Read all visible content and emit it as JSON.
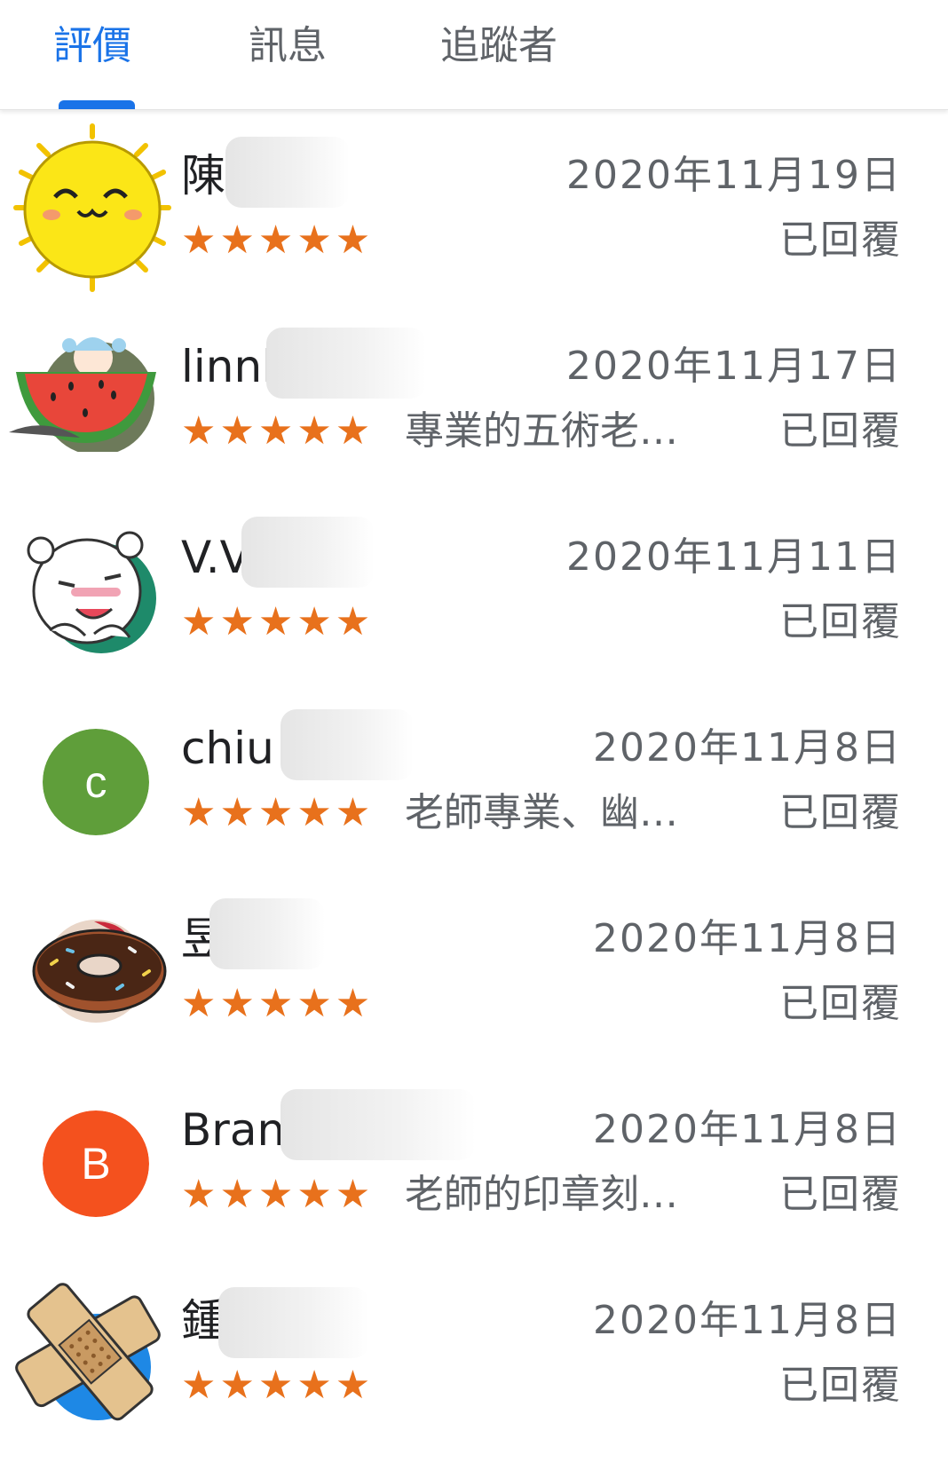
{
  "tabs": [
    {
      "label": "評價",
      "active": true
    },
    {
      "label": "訊息",
      "active": false
    },
    {
      "label": "追蹤者",
      "active": false
    }
  ],
  "colors": {
    "accent": "#1a73e8",
    "star": "#e8711c",
    "secondary_text": "#5f6368"
  },
  "reviews": [
    {
      "name": "陳",
      "stars": "★★★★★",
      "rating": 5,
      "snippet": "",
      "date": "2020年11月19日",
      "status": "已回覆",
      "avatar": "sun-avatar"
    },
    {
      "name": "linnl",
      "stars": "★★★★★",
      "rating": 5,
      "snippet": "專業的五術老…",
      "date": "2020年11月17日",
      "status": "已回覆",
      "avatar": "watermelon-avatar"
    },
    {
      "name": "V.V",
      "stars": "★★★★★",
      "rating": 5,
      "snippet": "",
      "date": "2020年11月11日",
      "status": "已回覆",
      "avatar": "bear-avatar"
    },
    {
      "name": "chiu",
      "stars": "★★★★★",
      "rating": 5,
      "snippet": "老師專業、幽…",
      "date": "2020年11月8日",
      "status": "已回覆",
      "avatar": "letter-avatar",
      "avatar_letter": "c",
      "avatar_color": "#5f9e3a"
    },
    {
      "name": "昱",
      "stars": "★★★★★",
      "rating": 5,
      "snippet": "",
      "date": "2020年11月8日",
      "status": "已回覆",
      "avatar": "donut-avatar"
    },
    {
      "name": "Bran",
      "stars": "★★★★★",
      "rating": 5,
      "snippet": "老師的印章刻…",
      "date": "2020年11月8日",
      "status": "已回覆",
      "avatar": "letter-avatar",
      "avatar_letter": "B",
      "avatar_color": "#f4511e"
    },
    {
      "name": "鍾",
      "stars": "★★★★★",
      "rating": 5,
      "snippet": "",
      "date": "2020年11月8日",
      "status": "已回覆",
      "avatar": "bandage-avatar"
    }
  ]
}
